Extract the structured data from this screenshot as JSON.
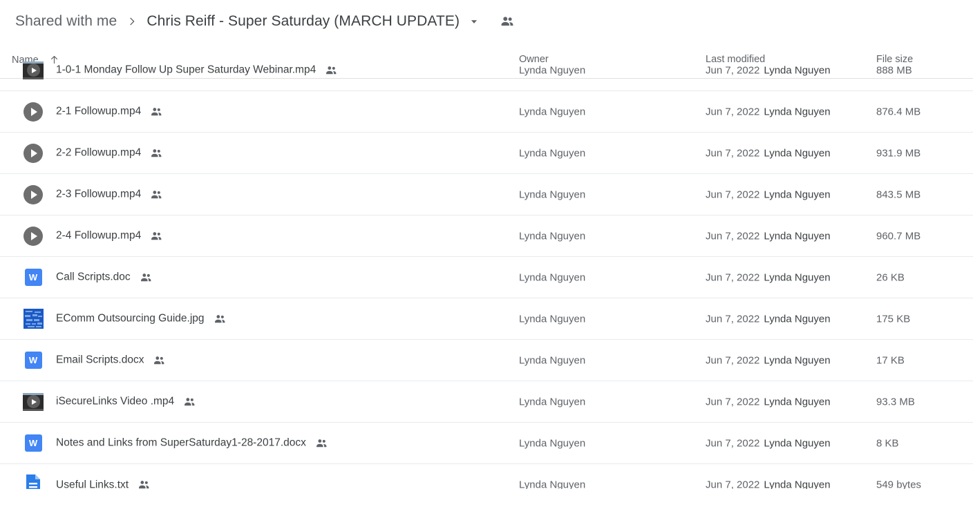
{
  "breadcrumb": {
    "root": "Shared with me",
    "separator_icon": "chevron-right-icon",
    "current": "Chris Reiff - Super Saturday (MARCH UPDATE)",
    "caret_icon": "triangle-down-icon",
    "people_icon": "people-icon"
  },
  "columns": {
    "name": "Name",
    "sort_icon": "arrow-up-icon",
    "owner": "Owner",
    "last_modified": "Last modified",
    "file_size": "File size"
  },
  "files": [
    {
      "icon": "video-thumbnail-icon",
      "name": "1-0-1 Monday Follow Up Super Saturday Webinar.mp4",
      "shared_icon": "people-icon",
      "owner": "Lynda Nguyen",
      "modified_date": "Jun 7, 2022",
      "modified_by": "Lynda Nguyen",
      "size": "888 MB"
    },
    {
      "icon": "video-play-icon",
      "name": "2-1 Followup.mp4",
      "shared_icon": "people-icon",
      "owner": "Lynda Nguyen",
      "modified_date": "Jun 7, 2022",
      "modified_by": "Lynda Nguyen",
      "size": "876.4 MB"
    },
    {
      "icon": "video-play-icon",
      "name": "2-2 Followup.mp4",
      "shared_icon": "people-icon",
      "owner": "Lynda Nguyen",
      "modified_date": "Jun 7, 2022",
      "modified_by": "Lynda Nguyen",
      "size": "931.9 MB"
    },
    {
      "icon": "video-play-icon",
      "name": "2-3 Followup.mp4",
      "shared_icon": "people-icon",
      "owner": "Lynda Nguyen",
      "modified_date": "Jun 7, 2022",
      "modified_by": "Lynda Nguyen",
      "size": "843.5 MB"
    },
    {
      "icon": "video-play-icon",
      "name": "2-4 Followup.mp4",
      "shared_icon": "people-icon",
      "owner": "Lynda Nguyen",
      "modified_date": "Jun 7, 2022",
      "modified_by": "Lynda Nguyen",
      "size": "960.7 MB"
    },
    {
      "icon": "word-document-icon",
      "name": "Call Scripts.doc",
      "shared_icon": "people-icon",
      "owner": "Lynda Nguyen",
      "modified_date": "Jun 7, 2022",
      "modified_by": "Lynda Nguyen",
      "size": "26 KB"
    },
    {
      "icon": "image-thumbnail-icon",
      "name": "EComm Outsourcing Guide.jpg",
      "shared_icon": "people-icon",
      "owner": "Lynda Nguyen",
      "modified_date": "Jun 7, 2022",
      "modified_by": "Lynda Nguyen",
      "size": "175 KB"
    },
    {
      "icon": "word-document-icon",
      "name": "Email Scripts.docx",
      "shared_icon": "people-icon",
      "owner": "Lynda Nguyen",
      "modified_date": "Jun 7, 2022",
      "modified_by": "Lynda Nguyen",
      "size": "17 KB"
    },
    {
      "icon": "video-thumbnail-icon",
      "name": "iSecureLinks Video .mp4",
      "shared_icon": "people-icon",
      "owner": "Lynda Nguyen",
      "modified_date": "Jun 7, 2022",
      "modified_by": "Lynda Nguyen",
      "size": "93.3 MB"
    },
    {
      "icon": "word-document-icon",
      "name": "Notes and Links from SuperSaturday1-28-2017.docx",
      "shared_icon": "people-icon",
      "owner": "Lynda Nguyen",
      "modified_date": "Jun 7, 2022",
      "modified_by": "Lynda Nguyen",
      "size": "8 KB"
    },
    {
      "icon": "text-document-icon",
      "name": "Useful Links.txt",
      "shared_icon": "people-icon",
      "owner": "Lynda Nguyen",
      "modified_date": "Jun 7, 2022",
      "modified_by": "Lynda Nguyen",
      "size": "549 bytes"
    }
  ],
  "colors": {
    "accent_blue": "#4285f4",
    "text_primary": "#3c4043",
    "text_secondary": "#5f6368",
    "divider": "#e8eaed"
  }
}
